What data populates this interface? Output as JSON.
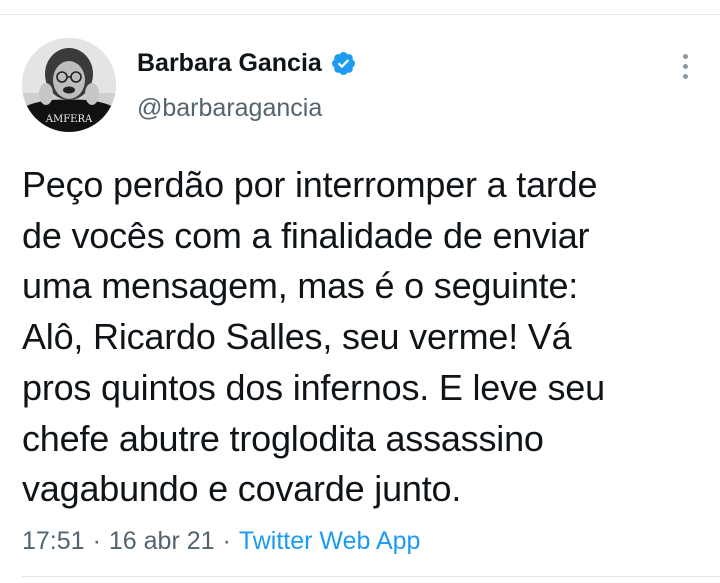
{
  "tweet": {
    "author": {
      "name": "Barbara Gancia",
      "handle": "@barbaragancia",
      "verified_icon": "verified-badge-icon",
      "avatar_text": "AMFERA"
    },
    "more_icon": "more-vertical-icon",
    "text": "Peço perdão por interromper a tarde\nde vocês com a finalidade de enviar\numa mensagem, mas é o seguinte:\nAlô, Ricardo Salles, seu verme! Vá\npros quintos dos infernos. E leve seu\nchefe abutre troglodita assassino\nvagabundo e covarde junto.",
    "time": "17:51",
    "separator": "·",
    "date": "16 abr 21",
    "source": "Twitter Web App"
  },
  "colors": {
    "text": "#0f1419",
    "secondary": "#536471",
    "link": "#1d9bf0",
    "verified": "#1d9bf0"
  }
}
